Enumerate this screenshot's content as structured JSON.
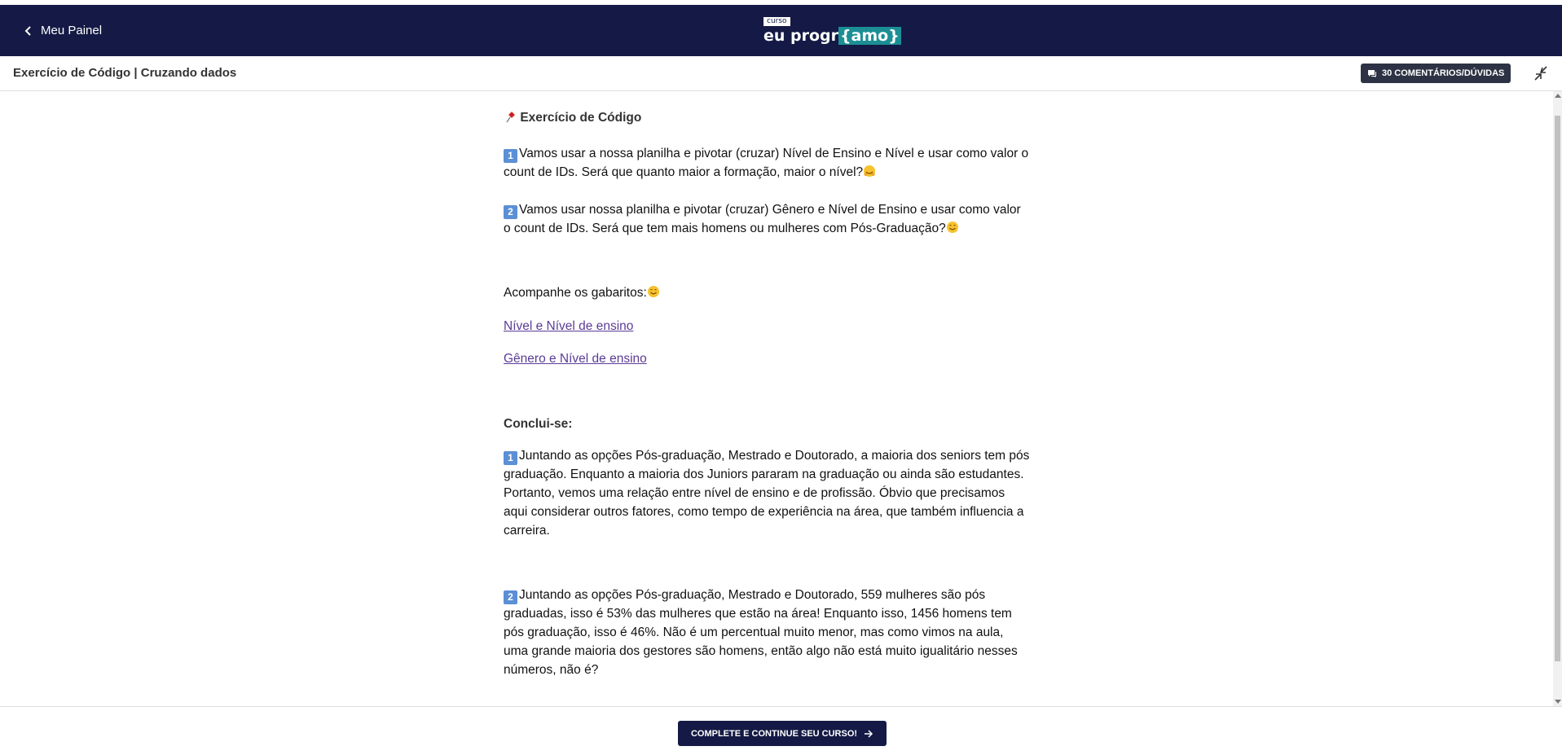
{
  "header": {
    "back_label": "Meu Painel",
    "logo_small": "curso",
    "logo_main_prefix": "eu progr",
    "logo_main_highlight": "{amo}",
    "lesson_title": "Exercício de Código | Cruzando dados",
    "comments_label": "30 COMENTÁRIOS/DÚVIDAS"
  },
  "article": {
    "heading": "Exercício de Código",
    "heading_icon": "pushpin-icon",
    "p1_num": "1",
    "p1_line1": "Vamos usar a nossa planilha e pivotar (cruzar) Nível de Ensino e Nível e usar como valor o",
    "p1_line2": "count de IDs. Será que quanto maior a formação, maior o nível?",
    "p2_num": "2",
    "p2_line1": "Vamos usar nossa planilha e pivotar (cruzar) Gênero e Nível de Ensino e usar como valor",
    "p2_line2": "o count de IDs. Será que tem mais homens ou mulheres com Pós-Graduação?",
    "answers_intro": "Acompanhe os gabaritos:",
    "link1": "Nível e Nível de ensino",
    "link2": "Gênero e Nível de ensino",
    "conclusion_heading": "Conclui-se:",
    "c1_num": "1",
    "c1_lines": [
      "Juntando as opções Pós-graduação, Mestrado e Doutorado, a maioria dos seniors tem pós",
      "graduação. Enquanto a maioria dos Juniors pararam na graduação ou ainda são estudantes.",
      "Portanto, vemos uma relação entre nível de ensino e de profissão. Óbvio que precisamos",
      "aqui considerar outros fatores, como tempo de experiência na área, que também influencia a",
      "carreira."
    ],
    "c2_num": "2",
    "c2_lines": [
      "Juntando as opções Pós-graduação, Mestrado e Doutorado, 559 mulheres são pós",
      "graduadas, isso é 53% das mulheres que estão na área! Enquanto isso, 1456 homens tem",
      "pós graduação, isso é 46%. Não é um percentual muito menor, mas como vimos na aula,",
      "uma grande maioria dos gestores são homens, então algo não está muito igualitário nesses",
      "números, não é?"
    ]
  },
  "footer": {
    "complete_label": "COMPLETE E CONTINUE SEU CURSO!"
  },
  "colors": {
    "navy": "#141a45",
    "teal": "#1c8f95",
    "link": "#5b3c96",
    "badge": "#2d3344"
  }
}
